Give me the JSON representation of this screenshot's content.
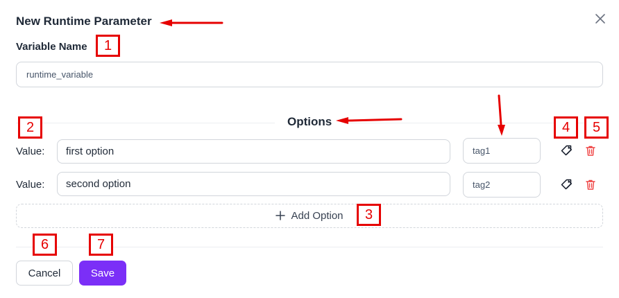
{
  "dialog": {
    "title": "New Runtime Parameter",
    "variable_label": "Variable Name",
    "variable_value": "runtime_variable",
    "options_heading": "Options",
    "options": [
      {
        "label": "Value:",
        "value": "first option",
        "tag": "tag1"
      },
      {
        "label": "Value:",
        "value": "second option",
        "tag": "tag2"
      }
    ],
    "add_option_label": "Add Option",
    "cancel_label": "Cancel",
    "save_label": "Save"
  },
  "icons": {
    "close": "close-icon",
    "tag": "tag-icon",
    "delete": "trash-icon",
    "add": "plus-icon"
  },
  "colors": {
    "accent": "#7b2ff7",
    "delete": "#ef4444",
    "annotation": "#e60000"
  },
  "annotations": [
    "1",
    "2",
    "3",
    "4",
    "5",
    "6",
    "7"
  ]
}
